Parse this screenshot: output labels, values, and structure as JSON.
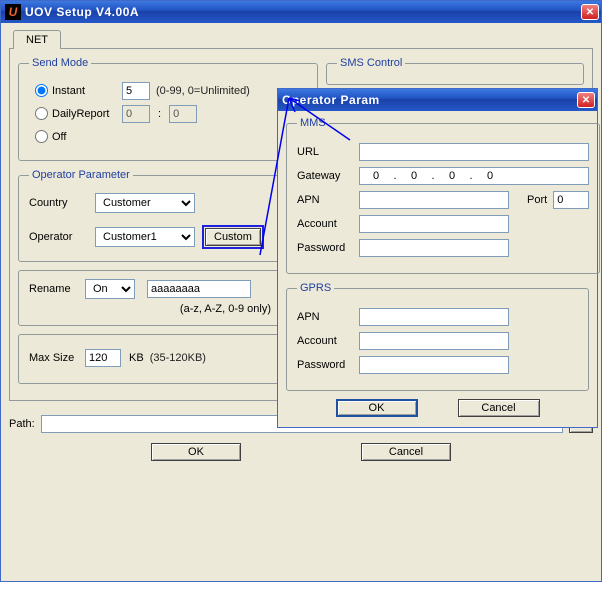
{
  "main": {
    "title": "UOV Setup V4.00A",
    "tabs": {
      "net": "NET"
    },
    "sendMode": {
      "legend": "Send Mode",
      "instant": "Instant",
      "instantValue": "5",
      "instantHint": "(0-99, 0=Unlimited)",
      "daily": "DailyReport",
      "dailyHour": "0",
      "dailyColon": ":",
      "dailyMin": "0",
      "off": "Off"
    },
    "smsControl": {
      "legend": "SMS Control"
    },
    "opParam": {
      "legend": "Operator Parameter",
      "countryLabel": "Country",
      "countryValue": "Customer",
      "operatorLabel": "Operator",
      "operatorValue": "Customer1",
      "customBtn": "Custom"
    },
    "rename": {
      "label": "Rename",
      "comboValue": "On",
      "textValue": "aaaaaaaa",
      "hint": "(a-z, A-Z, 0-9 only)"
    },
    "maxsize": {
      "label": "Max Size",
      "value": "120",
      "unit": "KB",
      "hint": "(35-120KB)"
    },
    "pathLabel": "Path:",
    "pathValue": "",
    "browseBtn": "...",
    "ok": "OK",
    "cancel": "Cancel"
  },
  "dialog": {
    "title": "Operator Param",
    "mms": {
      "legend": "MMS",
      "url": "URL",
      "urlValue": "",
      "gateway": "Gateway",
      "gatewayOct": [
        "0",
        "0",
        "0",
        "0"
      ],
      "dot": ".",
      "apn": "APN",
      "apnValue": "",
      "port": "Port",
      "portValue": "0",
      "account": "Account",
      "accountValue": "",
      "password": "Password",
      "passwordValue": ""
    },
    "gprs": {
      "legend": "GPRS",
      "apn": "APN",
      "apnValue": "",
      "account": "Account",
      "accountValue": "",
      "password": "Password",
      "passwordValue": ""
    },
    "ok": "OK",
    "cancel": "Cancel"
  }
}
